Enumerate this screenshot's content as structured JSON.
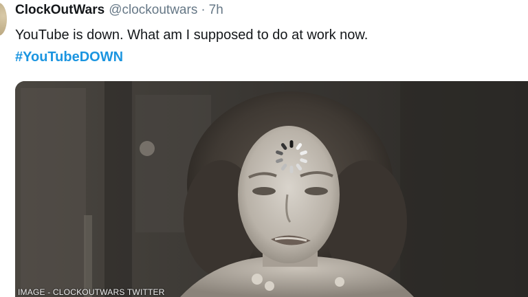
{
  "tweet": {
    "display_name": "ClockOutWars",
    "handle": "@clockoutwars",
    "separator": "·",
    "time": "7h",
    "text": "YouTube is down. What am I supposed to do at work now.",
    "hashtag": "#YouTubeDOWN",
    "link_color": "#1b95e0"
  },
  "media": {
    "caption": "IMAGE - CLOCKOUTWARS TWITTER",
    "icon": "loading-spinner-icon"
  }
}
